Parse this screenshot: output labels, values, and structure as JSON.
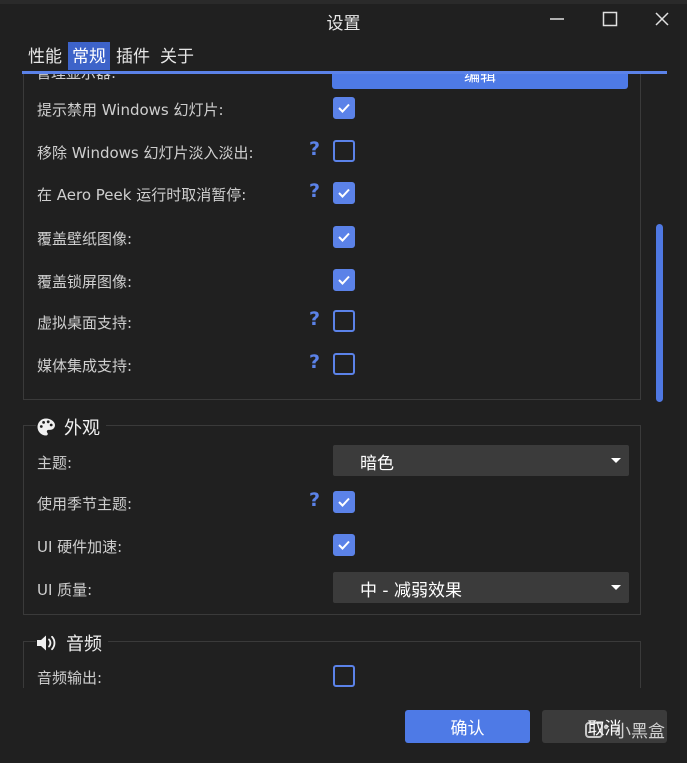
{
  "window": {
    "title": "设置"
  },
  "tabs": [
    {
      "label": "性能",
      "active": false
    },
    {
      "label": "常规",
      "active": true
    },
    {
      "label": "插件",
      "active": false
    },
    {
      "label": "关于",
      "active": false
    }
  ],
  "general": {
    "cut_label": "管理显示器:",
    "edit_button": "编辑",
    "rows": [
      {
        "label": "提示禁用 Windows 幻灯片:",
        "help": false,
        "checked": true
      },
      {
        "label": "移除 Windows 幻灯片淡入淡出:",
        "help": true,
        "checked": false
      },
      {
        "label": "在 Aero Peek 运行时取消暂停:",
        "help": true,
        "checked": true
      },
      {
        "label": "覆盖壁纸图像:",
        "help": false,
        "checked": true
      },
      {
        "label": "覆盖锁屏图像:",
        "help": false,
        "checked": true
      },
      {
        "label": "虚拟桌面支持:",
        "help": true,
        "checked": false
      },
      {
        "label": "媒体集成支持:",
        "help": true,
        "checked": false
      }
    ],
    "help_symbol": "?"
  },
  "appearance": {
    "heading": "外观",
    "theme_label": "主题:",
    "theme_value": "暗色",
    "seasonal_label": "使用季节主题:",
    "hw_accel_label": "UI 硬件加速:",
    "quality_label": "UI 质量:",
    "quality_value": "中 - 减弱效果"
  },
  "audio": {
    "heading": "音频",
    "output_label": "音频输出:"
  },
  "footer": {
    "ok_label": "确认",
    "cancel_label": "取消"
  },
  "watermark": {
    "text": "小黑盒"
  },
  "colors": {
    "accent": "#5b82e8",
    "button_primary": "#4e7ae6",
    "background": "#202020",
    "select_bg": "#3b3b3b"
  }
}
